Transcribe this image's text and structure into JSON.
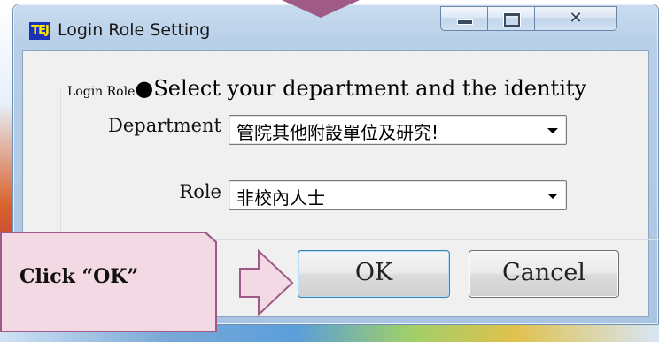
{
  "window": {
    "title": "Login Role Setting",
    "app_icon_text": "TEJ",
    "icons": [
      "app-icon",
      "minimize-icon",
      "maximize-icon",
      "close-icon"
    ]
  },
  "group": {
    "legend_small": "Login Role",
    "legend_note": "●Select your department and the identity"
  },
  "department": {
    "label": "Department",
    "selected": "管院其他附設單位及研究!"
  },
  "role": {
    "label": "Role",
    "selected": "非校內人士"
  },
  "buttons": {
    "ok": "OK",
    "cancel": "Cancel"
  },
  "callout": {
    "text": "Click “OK”"
  },
  "colors": {
    "callout_fill": "#f3d9e3",
    "callout_stroke": "#a05a86",
    "app_icon_bg": "#1b31b8",
    "app_icon_text": "#ffe600"
  }
}
